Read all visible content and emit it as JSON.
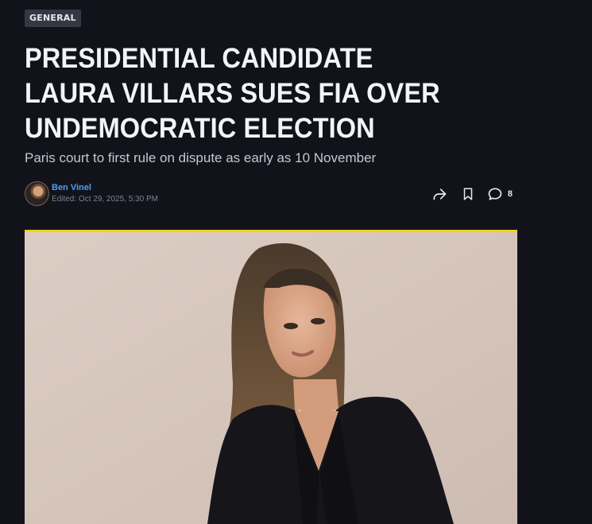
{
  "article": {
    "category": "GENERAL",
    "headline": "PRESIDENTIAL CANDIDATE LAURA VILLARS SUES FIA OVER UNDEMOCRATIC ELECTION",
    "subheadline": "Paris court to first rule on dispute as early as 10 November"
  },
  "byline": {
    "author": "Ben Vinel",
    "edited_prefix": "Edited:",
    "edited_date": "Oct 29, 2025, 5:30 PM"
  },
  "actions": {
    "share_icon": "share-icon",
    "bookmark_icon": "bookmark-icon",
    "comment_icon": "comment-icon",
    "comment_count": "8"
  },
  "hero": {
    "accent_color": "#f3d31b",
    "image_icon": "portrait-photo"
  },
  "colors": {
    "background": "#12131a",
    "author_link": "#4d9ef2",
    "badge_bg": "#343844"
  }
}
